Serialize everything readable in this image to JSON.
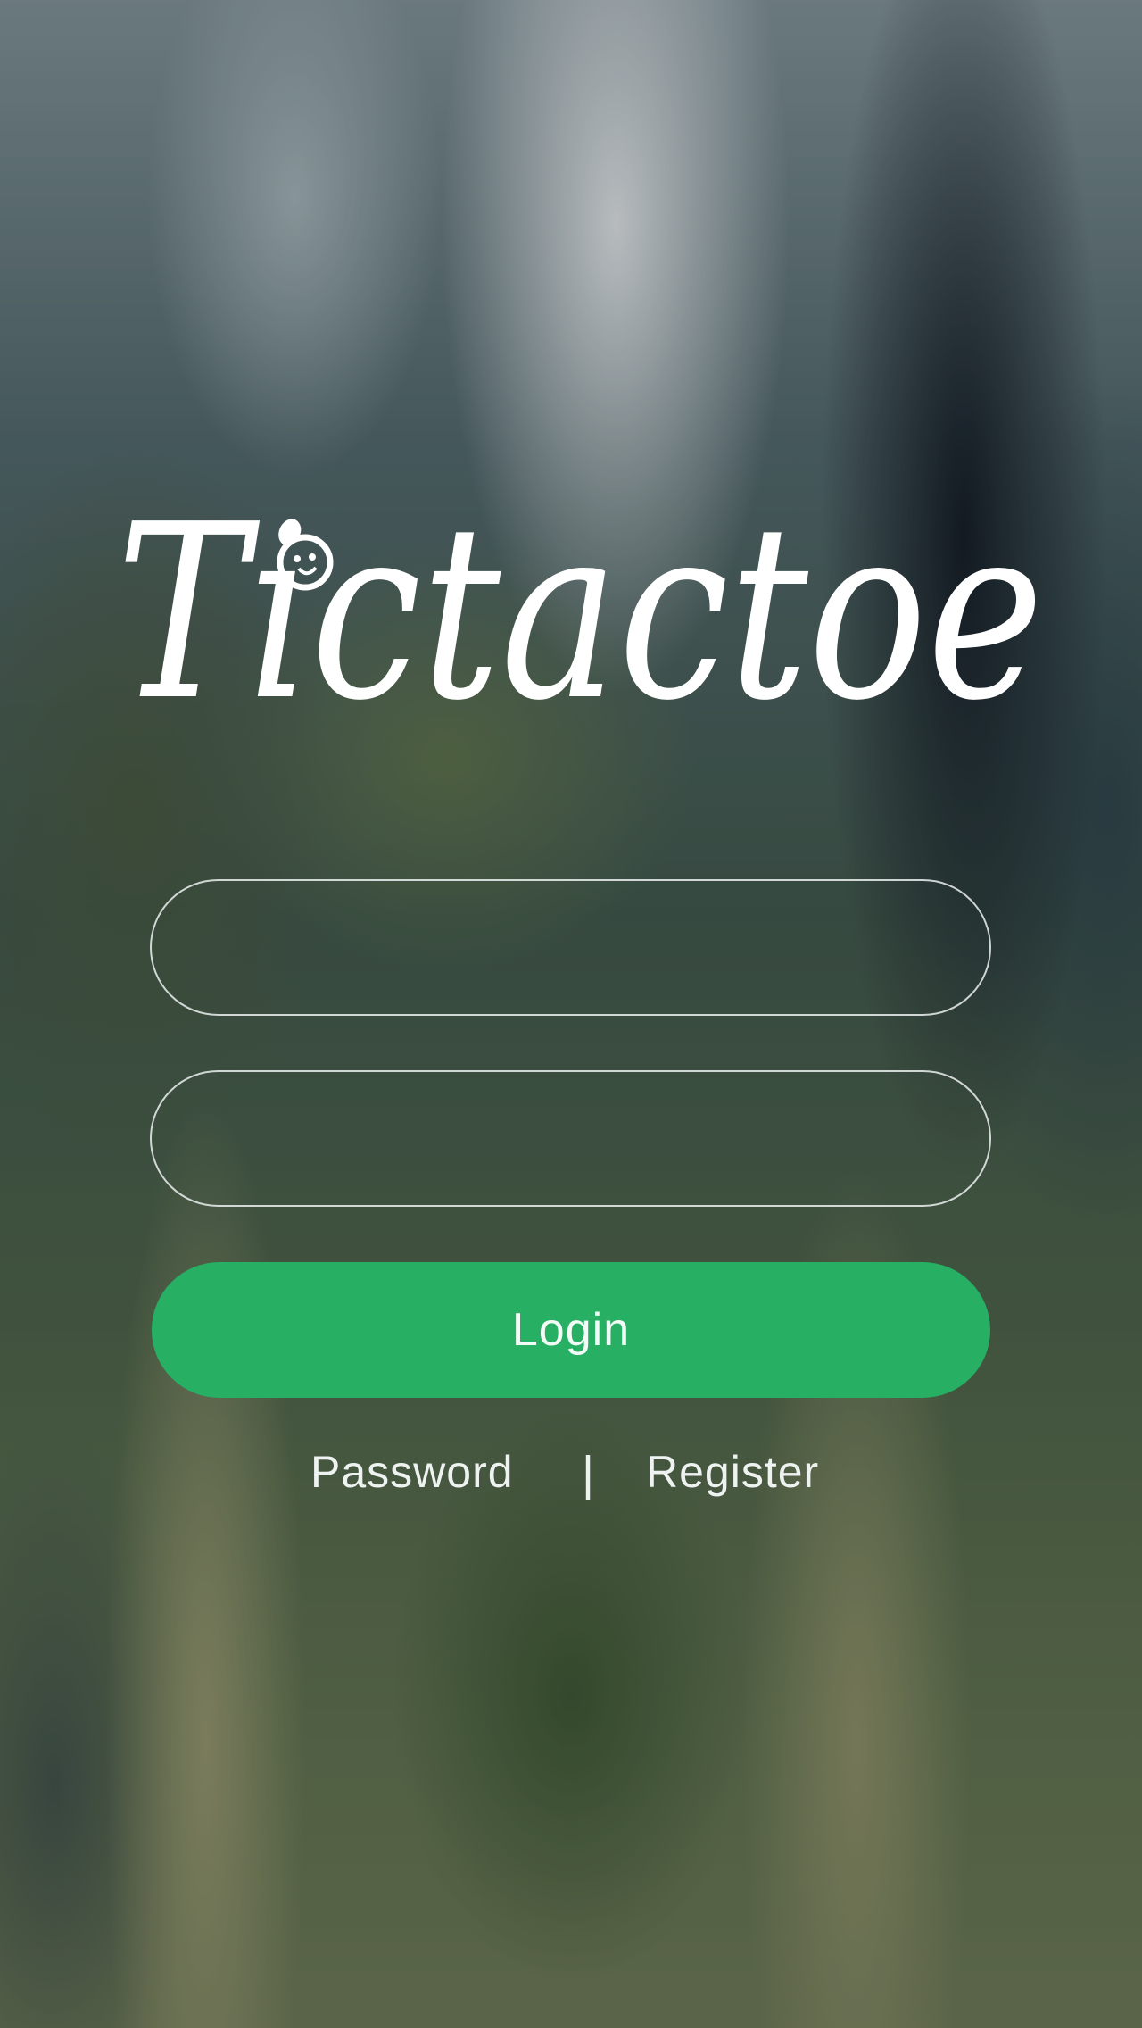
{
  "app": {
    "logo_text": "Tictactoe"
  },
  "form": {
    "username": {
      "value": "",
      "placeholder": ""
    },
    "password": {
      "value": "",
      "placeholder": ""
    },
    "login_label": "Login"
  },
  "footer": {
    "password_link": "Password",
    "separator": "|",
    "register_link": "Register"
  },
  "colors": {
    "accent": "#27b064",
    "text": "#ffffff"
  }
}
